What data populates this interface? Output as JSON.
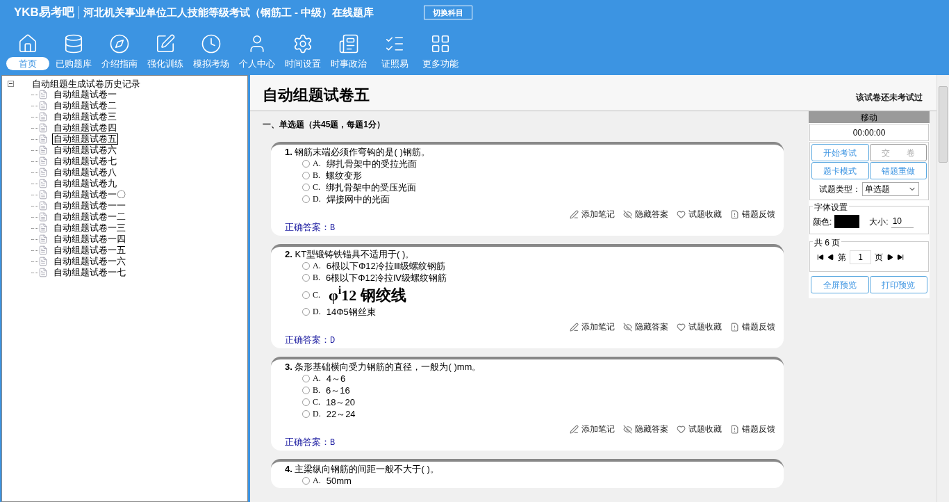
{
  "header": {
    "logo": "YKB易考吧",
    "title": "河北机关事业单位工人技能等级考试（钢筋工 - 中级）在线题库",
    "switch_button": "切换科目"
  },
  "nav": [
    {
      "label": "首页",
      "selected": true
    },
    {
      "label": "已购题库",
      "selected": false
    },
    {
      "label": "介绍指南",
      "selected": false
    },
    {
      "label": "强化训练",
      "selected": false
    },
    {
      "label": "模拟考场",
      "selected": false
    },
    {
      "label": "个人中心",
      "selected": false
    },
    {
      "label": "时间设置",
      "selected": false
    },
    {
      "label": "时事政治",
      "selected": false
    },
    {
      "label": "证照易",
      "selected": false
    },
    {
      "label": "更多功能",
      "selected": false
    }
  ],
  "tree": {
    "label": "自动组题生成试卷历史记录",
    "expanded": true,
    "children": [
      {
        "label": "自动组题试卷一",
        "selected": false
      },
      {
        "label": "自动组题试卷二",
        "selected": false
      },
      {
        "label": "自动组题试卷三",
        "selected": false
      },
      {
        "label": "自动组题试卷四",
        "selected": false
      },
      {
        "label": "自动组题试卷五",
        "selected": true
      },
      {
        "label": "自动组题试卷六",
        "selected": false
      },
      {
        "label": "自动组题试卷七",
        "selected": false
      },
      {
        "label": "自动组题试卷八",
        "selected": false
      },
      {
        "label": "自动组题试卷九",
        "selected": false
      },
      {
        "label": "自动组题试卷一〇",
        "selected": false
      },
      {
        "label": "自动组题试卷一一",
        "selected": false
      },
      {
        "label": "自动组题试卷一二",
        "selected": false
      },
      {
        "label": "自动组题试卷一三",
        "selected": false
      },
      {
        "label": "自动组题试卷一四",
        "selected": false
      },
      {
        "label": "自动组题试卷一五",
        "selected": false
      },
      {
        "label": "自动组题试卷一六",
        "selected": false
      },
      {
        "label": "自动组题试卷一七",
        "selected": false
      }
    ]
  },
  "paper": {
    "title": "自动组题试卷五",
    "status": "该试卷还未考试过",
    "section": "一、单选题（共45题，每题1分）",
    "questions": [
      {
        "number": "1.",
        "text": "钢筋末端必须作弯钩的是( )钢筋。",
        "options": [
          {
            "letter": "A.",
            "text": "绑扎骨架中的受拉光面",
            "kind": "text",
            "selected": false
          },
          {
            "letter": "B.",
            "text": "螺纹变形",
            "kind": "text",
            "selected": false
          },
          {
            "letter": "C.",
            "text": "绑扎骨架中的受压光面",
            "kind": "text",
            "selected": false
          },
          {
            "letter": "D.",
            "text": "焊接网中的光面",
            "kind": "text",
            "selected": false
          }
        ],
        "answer_label": "正确答案：",
        "answer": "B",
        "actions": [
          {
            "label": "添加笔记",
            "kind": "note"
          },
          {
            "label": "隐藏答案",
            "kind": "hide"
          },
          {
            "label": "试题收藏",
            "kind": "favorite"
          },
          {
            "label": "错题反馈",
            "kind": "report"
          }
        ]
      },
      {
        "number": "2.",
        "text": "KT型锻铸铁锚具不适用于( )。",
        "options": [
          {
            "letter": "A.",
            "text": "6根以下Φ12冷拉Ⅲ级螺纹钢筋",
            "kind": "text",
            "selected": false
          },
          {
            "letter": "B.",
            "text": "6根以下Φ12冷拉Ⅳ级螺纹钢筋",
            "kind": "text",
            "selected": false
          },
          {
            "letter": "C.",
            "text": "φ$^{i}$12 钢绞线",
            "kind": "image",
            "selected": false
          },
          {
            "letter": "D.",
            "text": "14Φ5钢丝束",
            "kind": "text",
            "selected": false
          }
        ],
        "answer_label": "正确答案：",
        "answer": "D",
        "actions": [
          {
            "label": "添加笔记",
            "kind": "note"
          },
          {
            "label": "隐藏答案",
            "kind": "hide"
          },
          {
            "label": "试题收藏",
            "kind": "favorite"
          },
          {
            "label": "错题反馈",
            "kind": "report"
          }
        ]
      },
      {
        "number": "3.",
        "text": "条形基础横向受力钢筋的直径，一般为( )mm。",
        "options": [
          {
            "letter": "A.",
            "text": "4～6",
            "kind": "text",
            "selected": false
          },
          {
            "letter": "B.",
            "text": "6～16",
            "kind": "text",
            "selected": false
          },
          {
            "letter": "C.",
            "text": "18～20",
            "kind": "text",
            "selected": false
          },
          {
            "letter": "D.",
            "text": "22～24",
            "kind": "text",
            "selected": false
          }
        ],
        "answer_label": "正确答案：",
        "answer": "B",
        "actions": [
          {
            "label": "添加笔记",
            "kind": "note"
          },
          {
            "label": "隐藏答案",
            "kind": "hide"
          },
          {
            "label": "试题收藏",
            "kind": "favorite"
          },
          {
            "label": "错题反馈",
            "kind": "report"
          }
        ]
      },
      {
        "number": "4.",
        "text": "主梁纵向钢筋的间距一般不大于( )。",
        "options": [
          {
            "letter": "A.",
            "text": "50mm",
            "kind": "text",
            "selected": false
          }
        ]
      }
    ]
  },
  "panel": {
    "move_label": "移动",
    "timer": "00:00:00",
    "buttons": [
      {
        "label": "开始考试",
        "disabled": false
      },
      {
        "label": "交　　卷",
        "disabled": true
      },
      {
        "label": "题卡模式",
        "disabled": false
      },
      {
        "label": "错题重做",
        "disabled": false
      }
    ],
    "type_label": "试题类型：",
    "type_value": "单选题",
    "font_group": "字体设置",
    "color_label": "颜色:",
    "size_label": "大小:",
    "size_value": "10",
    "pages_group": "共 6 页",
    "page_prefix": "第",
    "page_value": "1",
    "page_suffix": "页",
    "bottom_buttons": [
      {
        "label": "全屏预览"
      },
      {
        "label": "打印预览"
      }
    ]
  }
}
